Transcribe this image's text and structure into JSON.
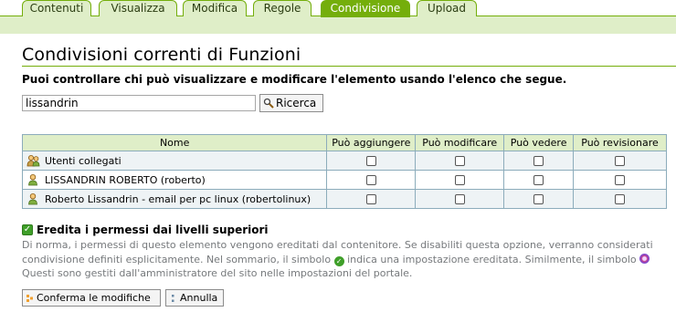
{
  "tabs": [
    {
      "label": "Contenuti",
      "active": false
    },
    {
      "label": "Visualizza",
      "active": false
    },
    {
      "label": "Modifica",
      "active": false
    },
    {
      "label": "Regole",
      "active": false
    },
    {
      "label": "Condivisione",
      "active": true
    },
    {
      "label": "Upload",
      "active": false
    }
  ],
  "page": {
    "title": "Condivisioni correnti di Funzioni",
    "lead": "Puoi controllare chi può visualizzare e modificare l'elemento usando l'elenco che segue."
  },
  "search": {
    "value": "lissandrin",
    "button_label": "Ricerca",
    "icon": "magnifier-icon"
  },
  "table": {
    "headers": [
      "Nome",
      "Può aggiungere",
      "Può modificare",
      "Può vedere",
      "Può revisionare"
    ],
    "rows": [
      {
        "name": "Utenti collegati",
        "icon": "group-icon",
        "checks": [
          false,
          false,
          false,
          false
        ]
      },
      {
        "name": "LISSANDRIN ROBERTO (roberto)",
        "icon": "user-icon",
        "checks": [
          false,
          false,
          false,
          false
        ]
      },
      {
        "name": "Roberto Lissandrin - email per pc linux (robertolinux)",
        "icon": "user-icon",
        "checks": [
          false,
          false,
          false,
          false
        ]
      }
    ]
  },
  "inherit": {
    "label": "Eredita i permessi dai livelli superiori",
    "checked": true,
    "help_part1": "Di norma, i permessi di questo elemento vengono ereditati dal contenitore. Se disabiliti questa opzione, verranno considerati condivisione definiti esplicitamente. Nel sommario, il simbolo",
    "help_part2": "indica una impostazione ereditata. Similmente, il simbolo",
    "help_part3": "Questi sono gestiti dall'amministratore del sito nelle impostazioni del portale."
  },
  "buttons": {
    "save_label": "Conferma le modifiche",
    "cancel_label": "Annulla"
  },
  "colors": {
    "accent": "#74ae0b",
    "tab_bg": "#dfeec8",
    "help_text": "#76797c"
  }
}
